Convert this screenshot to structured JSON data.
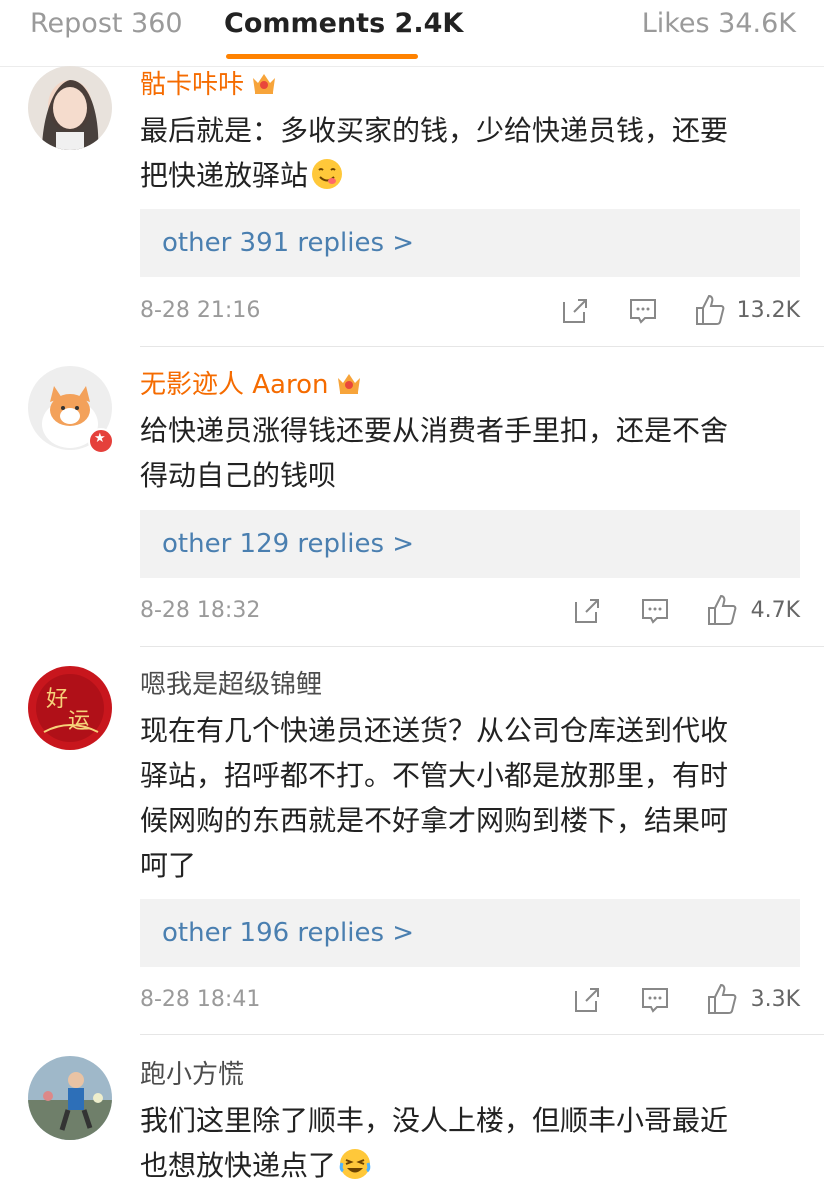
{
  "tabs": {
    "repost": "Repost 360",
    "comments": "Comments 2.4K",
    "likes": "Likes 34.6K"
  },
  "accent_color": "#ff8200",
  "comments": [
    {
      "username": "骷卡咔咔",
      "lines": [
        "最后就是：多收买家的钱，少给快递员钱，还要",
        "把快递放驿站"
      ],
      "replies": "other 391 replies >",
      "time": "8-28 21:16",
      "likes": "13.2K"
    },
    {
      "username": "无影迹人 Aaron",
      "lines": [
        "给快递员涨得钱还要从消费者手里扣，还是不舍",
        "得动自己的钱呗"
      ],
      "replies": "other 129 replies >",
      "time": "8-28 18:32",
      "likes": "4.7K"
    },
    {
      "username": "嗯我是超级锦鲤",
      "lines": [
        "现在有几个快递员还送货？从公司仓库送到代收",
        "驿站，招呼都不打。不管大小都是放那里，有时",
        "候网购的东西就是不好拿才网购到楼下，结果呵",
        "呵了"
      ],
      "replies": "other 196 replies >",
      "time": "8-28 18:41",
      "likes": "3.3K"
    },
    {
      "username": "跑小方慌",
      "lines": [
        "我们这里除了顺丰，没人上楼，但顺丰小哥最近",
        "也想放快递点了"
      ]
    }
  ]
}
